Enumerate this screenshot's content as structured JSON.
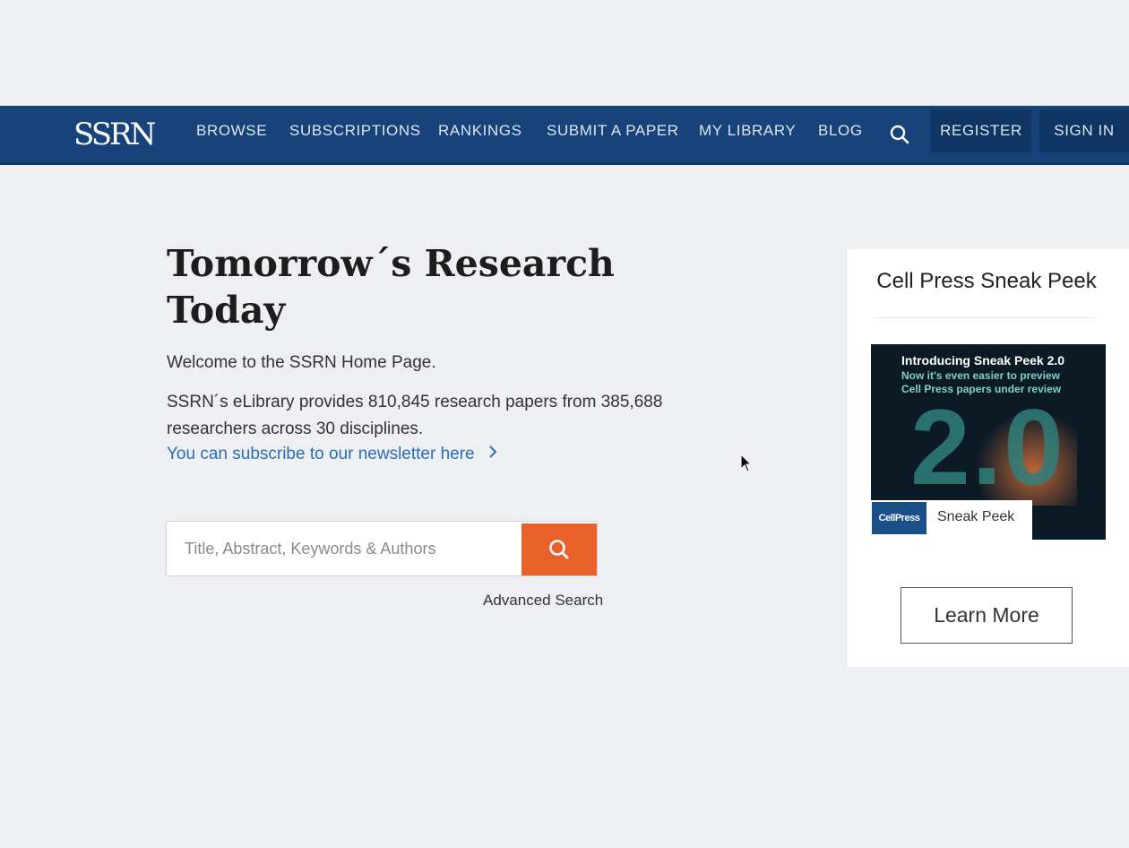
{
  "nav": {
    "logo": "SSRN",
    "links": [
      "BROWSE",
      "SUBSCRIPTIONS",
      "RANKINGS",
      "SUBMIT A PAPER",
      "MY LIBRARY",
      "BLOG"
    ],
    "search_icon": "search-icon",
    "register": "REGISTER",
    "signin": "SIGN IN"
  },
  "hero": {
    "title": "Tomorrow´s Research Today",
    "welcome": "Welcome to the SSRN Home Page.",
    "stats": "SSRN´s eLibrary provides 810,845 research papers from 385,688 researchers across 30 disciplines.",
    "newsletter": "You can subscribe to our newsletter here",
    "newsletter_icon": "chevron-right-icon"
  },
  "search": {
    "placeholder": "Title, Abstract, Keywords & Authors",
    "button_icon": "search-icon",
    "advanced": "Advanced Search"
  },
  "sidebar": {
    "title": "Cell Press Sneak Peek",
    "promo": {
      "line1": "Introducing Sneak Peek 2.0",
      "line2": "Now it's even easier to preview",
      "line3": "Cell Press papers under review",
      "big": "2.0",
      "badge": "CellPress",
      "label": "Sneak Peek"
    },
    "button": "Learn More"
  },
  "colors": {
    "nav_bg": "#17427a",
    "accent_orange": "#e8602a",
    "link_blue": "#2a6ebb",
    "page_bg": "#eeeff2"
  }
}
